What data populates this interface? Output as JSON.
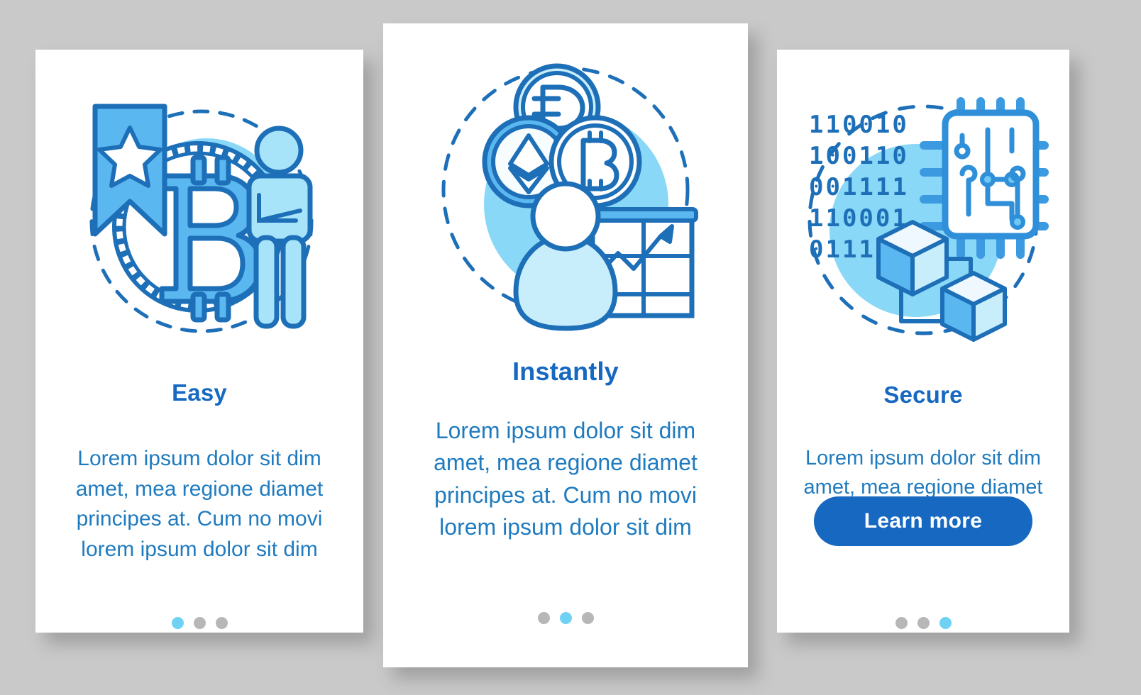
{
  "page": {
    "background_color": "#c9c9c9",
    "title_color": "#1668c0",
    "body_text_color": "#1f7bbf",
    "accent_color": "#1668c0",
    "dot_active_color": "#6fd2f5",
    "dot_inactive_color": "#b7b7b7"
  },
  "cards": [
    {
      "id": "easy",
      "title": "Easy",
      "body": "Lorem ipsum dolor sit dim\namet, mea regione diamet\nprincipes at. Cum no movi\nlorem ipsum dolor sit dim",
      "illustration": "bitcoin-bookmark-person-illustration",
      "dots": [
        true,
        false,
        false
      ],
      "button": null
    },
    {
      "id": "instantly",
      "title": "Instantly",
      "body": "Lorem ipsum dolor sit dim\namet, mea regione diamet\nprincipes at. Cum no movi\nlorem ipsum dolor sit dim",
      "illustration": "crypto-coins-person-chart-illustration",
      "coin_symbols": [
        "D",
        "E",
        "B"
      ],
      "dots": [
        false,
        true,
        false
      ],
      "button": null
    },
    {
      "id": "secure",
      "title": "Secure",
      "body": "Lorem ipsum dolor sit dim\namet, mea regione diamet",
      "illustration": "binary-microchip-blocks-illustration",
      "binary_rows": [
        "110010",
        "100110",
        "001111",
        "110001",
        "011110"
      ],
      "dots": [
        false,
        false,
        true
      ],
      "button": {
        "label": "Learn more"
      }
    }
  ]
}
